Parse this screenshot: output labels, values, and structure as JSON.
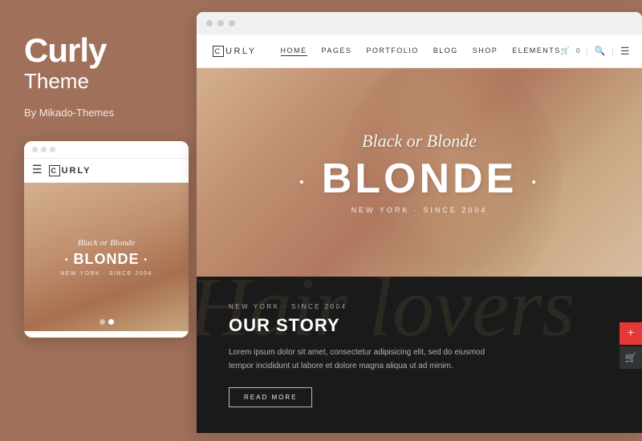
{
  "brand": {
    "title": "Curly",
    "subtitle": "Theme",
    "by": "By Mikado-Themes"
  },
  "mobile": {
    "dots": [
      "dot1",
      "dot2",
      "dot3"
    ],
    "logo_letter": "C",
    "logo_text": "URLY",
    "hamburger": "☰",
    "hero_script": "Black or Blonde",
    "hero_bold_pre_dot": "•",
    "hero_bold_text": "BLONDE",
    "hero_bold_post_dot": "•",
    "hero_location": "NEW YORK · SINCE 2004",
    "indicators": [
      {
        "active": false
      },
      {
        "active": true
      }
    ]
  },
  "desktop": {
    "title_bar_dots": [
      "d1",
      "d2",
      "d3"
    ],
    "logo_letter": "C",
    "logo_text": "URLY",
    "nav_links": [
      {
        "label": "HOME",
        "active": true
      },
      {
        "label": "PAGES",
        "active": false
      },
      {
        "label": "PORTFOLIO",
        "active": false
      },
      {
        "label": "BLOG",
        "active": false
      },
      {
        "label": "SHOP",
        "active": false
      },
      {
        "label": "ELEMENTS",
        "active": false
      }
    ],
    "nav_icons": {
      "cart": "🛒",
      "cart_count": "0",
      "search": "🔍",
      "menu": "☰"
    },
    "hero": {
      "script": "Black or Blonde",
      "bold_pre_dot": "•",
      "bold_text": "BLONDE",
      "bold_post_dot": "•",
      "location": "NEW YORK · SINCE 2004"
    },
    "story": {
      "bg_script": "Hair lovers",
      "eyebrow": "NEW YORK · SINCE 2004",
      "title": "OUR STORY",
      "body": "Lorem ipsum dolor sit amet, consectetur adipisicing elit, sed do eiusmod tempor incididunt ut labore et dolore magna aliqua ut ad minim.",
      "button_label": "READ MORE"
    },
    "fab": {
      "icon1": "⊕",
      "icon2": "🛒"
    }
  }
}
